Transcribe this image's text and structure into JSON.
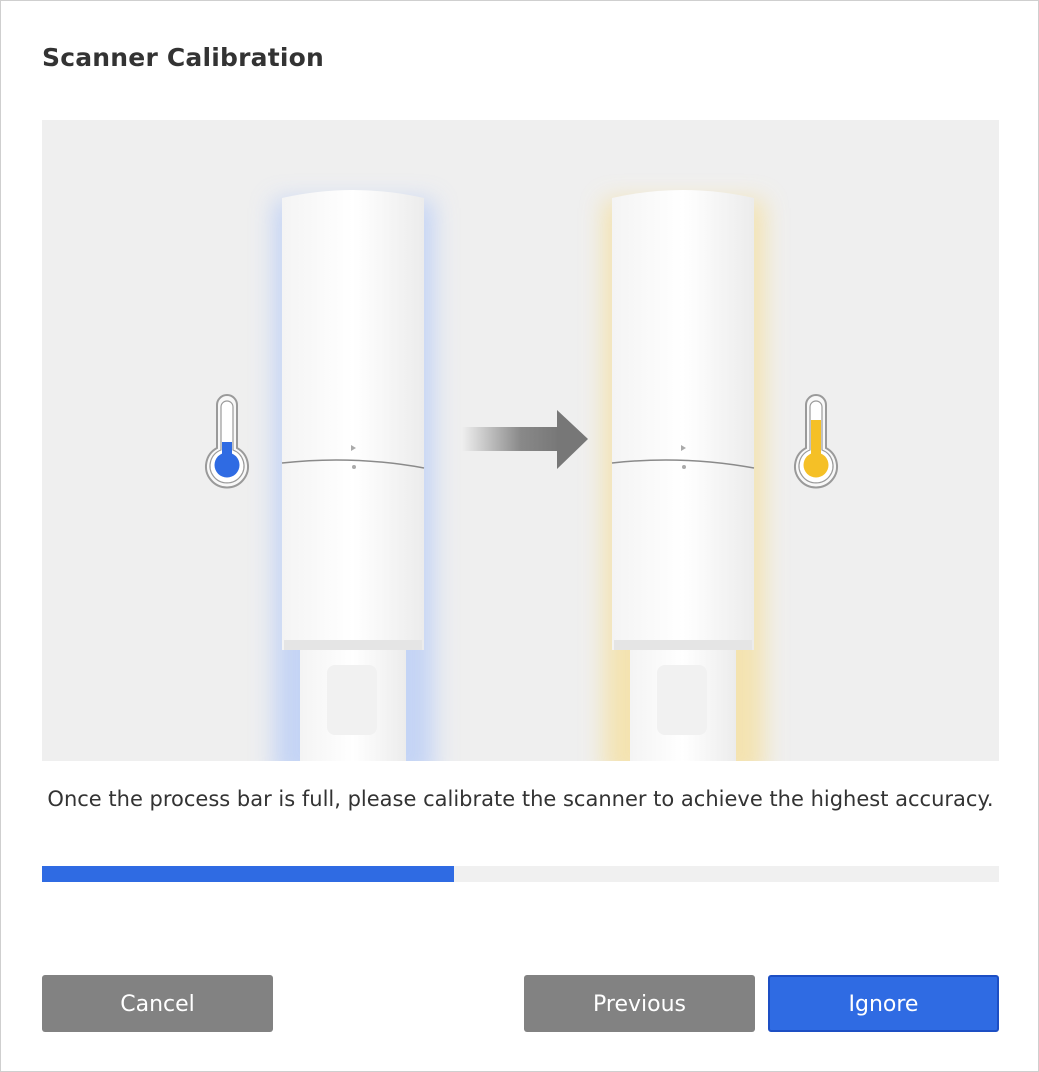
{
  "dialog": {
    "title": "Scanner Calibration",
    "message": "Once the process bar is full, please calibrate the scanner to achieve the highest accuracy.",
    "progress_fraction": 0.43
  },
  "illustration": {
    "cold_color": "#2f6be3",
    "warm_color": "#f5c026",
    "icons": [
      "thermometer-cold-icon",
      "arrow-right-icon",
      "thermometer-warm-icon"
    ]
  },
  "buttons": {
    "cancel_label": "Cancel",
    "previous_label": "Previous",
    "ignore_label": "Ignore"
  },
  "colors": {
    "accent": "#2f6be3",
    "secondary_button": "#828282",
    "progress_track": "#f0f0f0"
  }
}
